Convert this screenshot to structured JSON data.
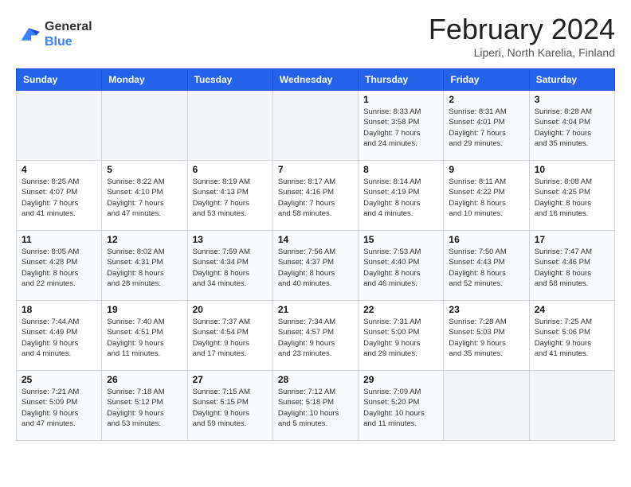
{
  "logo": {
    "line1": "General",
    "line2": "Blue"
  },
  "title": "February 2024",
  "location": "Liperi, North Karelia, Finland",
  "days_of_week": [
    "Sunday",
    "Monday",
    "Tuesday",
    "Wednesday",
    "Thursday",
    "Friday",
    "Saturday"
  ],
  "weeks": [
    [
      {
        "day": "",
        "info": ""
      },
      {
        "day": "",
        "info": ""
      },
      {
        "day": "",
        "info": ""
      },
      {
        "day": "",
        "info": ""
      },
      {
        "day": "1",
        "info": "Sunrise: 8:33 AM\nSunset: 3:58 PM\nDaylight: 7 hours\nand 24 minutes."
      },
      {
        "day": "2",
        "info": "Sunrise: 8:31 AM\nSunset: 4:01 PM\nDaylight: 7 hours\nand 29 minutes."
      },
      {
        "day": "3",
        "info": "Sunrise: 8:28 AM\nSunset: 4:04 PM\nDaylight: 7 hours\nand 35 minutes."
      }
    ],
    [
      {
        "day": "4",
        "info": "Sunrise: 8:25 AM\nSunset: 4:07 PM\nDaylight: 7 hours\nand 41 minutes."
      },
      {
        "day": "5",
        "info": "Sunrise: 8:22 AM\nSunset: 4:10 PM\nDaylight: 7 hours\nand 47 minutes."
      },
      {
        "day": "6",
        "info": "Sunrise: 8:19 AM\nSunset: 4:13 PM\nDaylight: 7 hours\nand 53 minutes."
      },
      {
        "day": "7",
        "info": "Sunrise: 8:17 AM\nSunset: 4:16 PM\nDaylight: 7 hours\nand 58 minutes."
      },
      {
        "day": "8",
        "info": "Sunrise: 8:14 AM\nSunset: 4:19 PM\nDaylight: 8 hours\nand 4 minutes."
      },
      {
        "day": "9",
        "info": "Sunrise: 8:11 AM\nSunset: 4:22 PM\nDaylight: 8 hours\nand 10 minutes."
      },
      {
        "day": "10",
        "info": "Sunrise: 8:08 AM\nSunset: 4:25 PM\nDaylight: 8 hours\nand 16 minutes."
      }
    ],
    [
      {
        "day": "11",
        "info": "Sunrise: 8:05 AM\nSunset: 4:28 PM\nDaylight: 8 hours\nand 22 minutes."
      },
      {
        "day": "12",
        "info": "Sunrise: 8:02 AM\nSunset: 4:31 PM\nDaylight: 8 hours\nand 28 minutes."
      },
      {
        "day": "13",
        "info": "Sunrise: 7:59 AM\nSunset: 4:34 PM\nDaylight: 8 hours\nand 34 minutes."
      },
      {
        "day": "14",
        "info": "Sunrise: 7:56 AM\nSunset: 4:37 PM\nDaylight: 8 hours\nand 40 minutes."
      },
      {
        "day": "15",
        "info": "Sunrise: 7:53 AM\nSunset: 4:40 PM\nDaylight: 8 hours\nand 46 minutes."
      },
      {
        "day": "16",
        "info": "Sunrise: 7:50 AM\nSunset: 4:43 PM\nDaylight: 8 hours\nand 52 minutes."
      },
      {
        "day": "17",
        "info": "Sunrise: 7:47 AM\nSunset: 4:46 PM\nDaylight: 8 hours\nand 58 minutes."
      }
    ],
    [
      {
        "day": "18",
        "info": "Sunrise: 7:44 AM\nSunset: 4:49 PM\nDaylight: 9 hours\nand 4 minutes."
      },
      {
        "day": "19",
        "info": "Sunrise: 7:40 AM\nSunset: 4:51 PM\nDaylight: 9 hours\nand 11 minutes."
      },
      {
        "day": "20",
        "info": "Sunrise: 7:37 AM\nSunset: 4:54 PM\nDaylight: 9 hours\nand 17 minutes."
      },
      {
        "day": "21",
        "info": "Sunrise: 7:34 AM\nSunset: 4:57 PM\nDaylight: 9 hours\nand 23 minutes."
      },
      {
        "day": "22",
        "info": "Sunrise: 7:31 AM\nSunset: 5:00 PM\nDaylight: 9 hours\nand 29 minutes."
      },
      {
        "day": "23",
        "info": "Sunrise: 7:28 AM\nSunset: 5:03 PM\nDaylight: 9 hours\nand 35 minutes."
      },
      {
        "day": "24",
        "info": "Sunrise: 7:25 AM\nSunset: 5:06 PM\nDaylight: 9 hours\nand 41 minutes."
      }
    ],
    [
      {
        "day": "25",
        "info": "Sunrise: 7:21 AM\nSunset: 5:09 PM\nDaylight: 9 hours\nand 47 minutes."
      },
      {
        "day": "26",
        "info": "Sunrise: 7:18 AM\nSunset: 5:12 PM\nDaylight: 9 hours\nand 53 minutes."
      },
      {
        "day": "27",
        "info": "Sunrise: 7:15 AM\nSunset: 5:15 PM\nDaylight: 9 hours\nand 59 minutes."
      },
      {
        "day": "28",
        "info": "Sunrise: 7:12 AM\nSunset: 5:18 PM\nDaylight: 10 hours\nand 5 minutes."
      },
      {
        "day": "29",
        "info": "Sunrise: 7:09 AM\nSunset: 5:20 PM\nDaylight: 10 hours\nand 11 minutes."
      },
      {
        "day": "",
        "info": ""
      },
      {
        "day": "",
        "info": ""
      }
    ]
  ]
}
